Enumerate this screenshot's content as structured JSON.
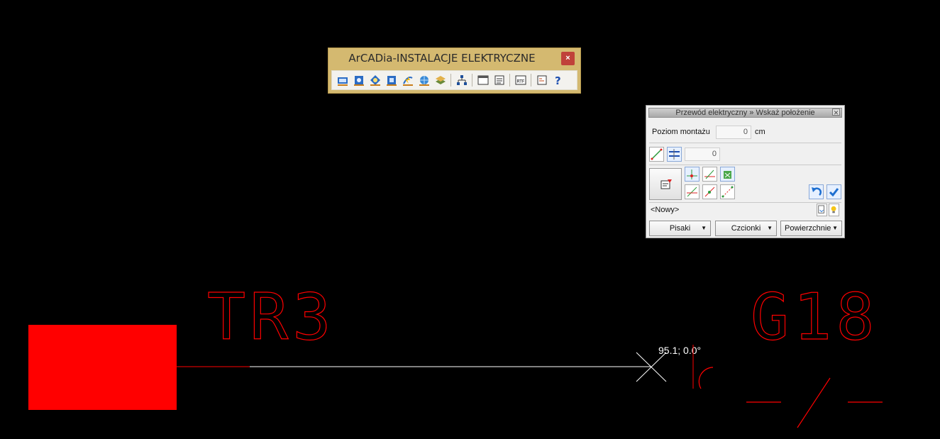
{
  "canvas": {
    "left_label": "TR3",
    "right_label": "G18",
    "cursor_readout": "95.1; 0.0°",
    "colors": {
      "background": "#000000",
      "entity": "#ff0000",
      "wire": "#ffffff"
    }
  },
  "toolbar": {
    "title": "ArCADia-INSTALACJE ELEKTRYCZNE",
    "close_label": "×",
    "buttons": [
      {
        "icon": "distribution-board-icon"
      },
      {
        "icon": "socket-icon"
      },
      {
        "icon": "lamp-icon"
      },
      {
        "icon": "switch-icon"
      },
      {
        "icon": "cable-icon"
      },
      {
        "icon": "globe-icon"
      },
      {
        "icon": "layers-icon"
      },
      {
        "icon": "scheme-icon"
      },
      {
        "icon": "window-icon"
      },
      {
        "icon": "list-icon"
      },
      {
        "icon": "rtf-export-icon"
      },
      {
        "icon": "settings-icon"
      },
      {
        "icon": "help-icon"
      }
    ]
  },
  "panel": {
    "title": "Przewód elektryczny » Wskaż położenie",
    "close_label": "✕",
    "mount_level_label": "Poziom montażu",
    "mount_level_value": "0",
    "mount_level_unit": "cm",
    "offset_value": "0",
    "name_value": "<Nowy>",
    "dropdowns": {
      "pens": "Pisaki",
      "fonts": "Czcionki",
      "surfaces": "Powierzchnie"
    }
  }
}
